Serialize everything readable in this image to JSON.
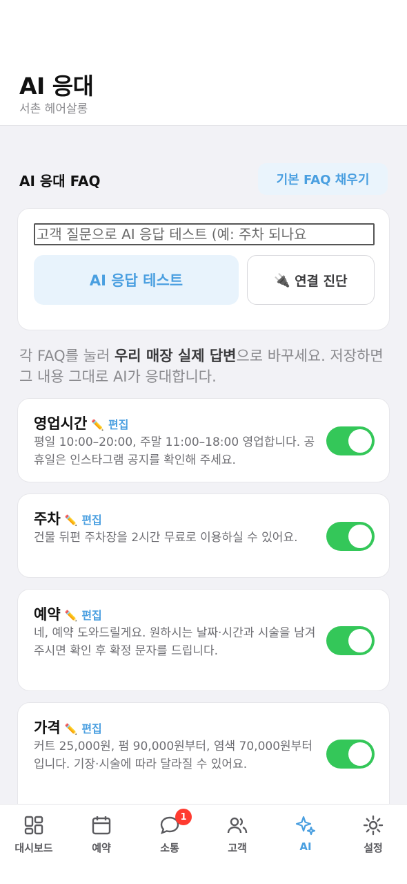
{
  "header": {
    "title": "AI 응대",
    "subtitle": "서촌 헤어살롱"
  },
  "faq_section": {
    "title": "AI 응대 FAQ",
    "fill_button": "기본 FAQ 채우기"
  },
  "test": {
    "input_placeholder": "고객 질문으로 AI 응답 테스트 (예: 주차 되나요",
    "test_button": "AI 응답 테스트",
    "diag_icon": "plug-icon",
    "diag_button": "연결 진단"
  },
  "help": {
    "prefix": "각 FAQ를 눌러 ",
    "bold": "우리 매장 실제 답변",
    "suffix": "으로 바꾸세요. 저장하면 그 내용 그대로 AI가 응대합니다."
  },
  "faqs": [
    {
      "title": "영업시간",
      "edit": "편집",
      "answer": "평일 10:00–20:00, 주말 11:00–18:00 영업합니다. 공휴일은 인스타그램 공지를 확인해 주세요.",
      "enabled": true
    },
    {
      "title": "주차",
      "edit": "편집",
      "answer": "건물 뒤편 주차장을 2시간 무료로 이용하실 수 있어요.",
      "enabled": true
    },
    {
      "title": "예약",
      "edit": "편집",
      "answer": "네, 예약 도와드릴게요. 원하시는 날짜·시간과 시술을 남겨 주시면 확인 후 확정 문자를 드립니다.",
      "enabled": true
    },
    {
      "title": "가격",
      "edit": "편집",
      "answer": "커트 25,000원, 펌 90,000원부터, 염색 70,000원부터입니다. 기장·시술에 따라 달라질 수 있어요.",
      "enabled": true
    }
  ],
  "tabbar": {
    "dashboard": "대시보드",
    "reservation": "예약",
    "chat": "소통",
    "chat_badge": "1",
    "customers": "고객",
    "ai": "AI",
    "settings": "설정"
  },
  "colors": {
    "accent": "#4a9fe0",
    "toggle_on": "#34c759",
    "badge": "#ff3b30"
  }
}
